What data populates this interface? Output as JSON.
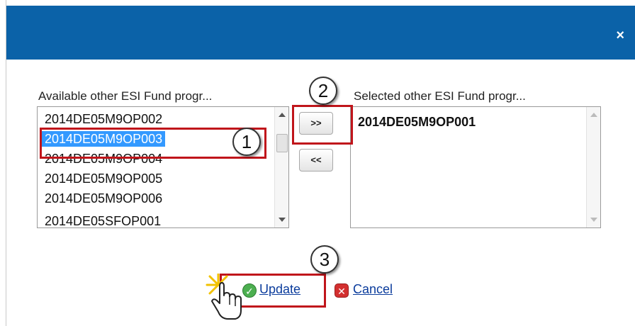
{
  "dialog": {
    "close_label": "×"
  },
  "available": {
    "label": "Available other ESI Fund progr...",
    "options": [
      {
        "label": "2014DE05M9OP002",
        "selected": false
      },
      {
        "label": "2014DE05M9OP003",
        "selected": true
      },
      {
        "label": "2014DE05M9OP004",
        "selected": false
      },
      {
        "label": "2014DE05M9OP005",
        "selected": false
      },
      {
        "label": "2014DE05M9OP006",
        "selected": false
      },
      {
        "label": "2014DE05SFOP001",
        "selected": false
      }
    ]
  },
  "selected": {
    "label": "Selected other ESI Fund progr...",
    "options": [
      {
        "label": "2014DE05M9OP001"
      }
    ]
  },
  "buttons": {
    "add_label": ">>",
    "remove_label": "<<"
  },
  "actions": {
    "update_label": "Update",
    "cancel_label": "Cancel"
  },
  "callouts": [
    "1",
    "2",
    "3"
  ],
  "colors": {
    "titlebar": "#0b62a8",
    "highlight": "#c0151b",
    "selection": "#3399ff",
    "link": "#0b3c9c",
    "ok_icon": "#4caf50",
    "cancel_icon": "#d32f2f"
  },
  "icons": {
    "close": "close-icon",
    "update": "check-circle-icon",
    "cancel": "x-square-icon",
    "cursor": "hand-pointer-icon"
  }
}
